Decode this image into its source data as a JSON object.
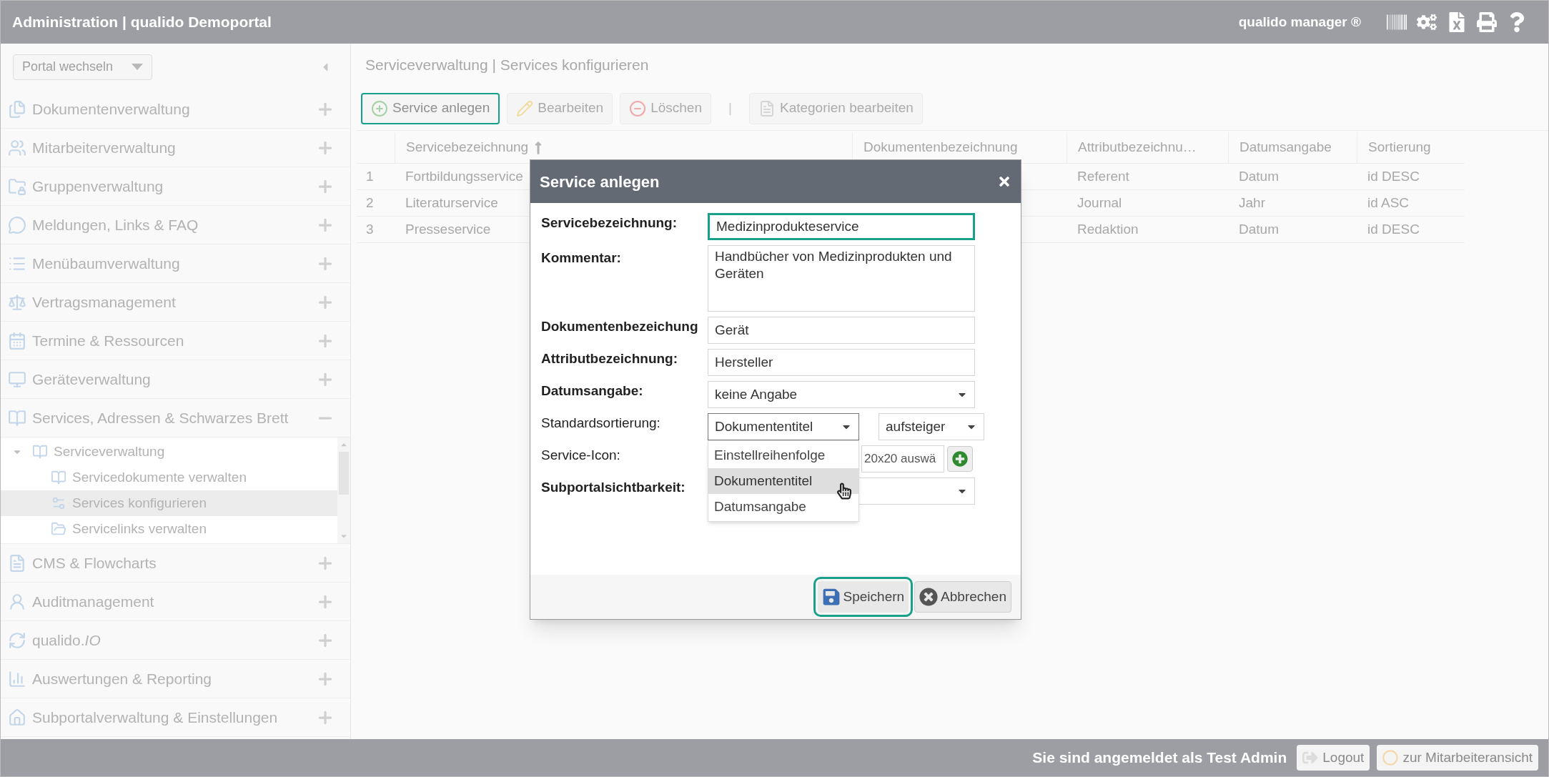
{
  "header": {
    "title": "Administration | qualido Demoportal",
    "product": "qualido manager ®"
  },
  "sidebar": {
    "portal_select": {
      "value": "Portal wechseln"
    },
    "items": [
      {
        "label": "Dokumentenverwaltung",
        "expanded": false
      },
      {
        "label": "Mitarbeiterverwaltung",
        "expanded": false
      },
      {
        "label": "Gruppenverwaltung",
        "expanded": false
      },
      {
        "label": "Meldungen, Links & FAQ",
        "expanded": false
      },
      {
        "label": "Menübaumverwaltung",
        "expanded": false
      },
      {
        "label": "Vertragsmanagement",
        "expanded": false
      },
      {
        "label": "Termine & Ressourcen",
        "expanded": false
      },
      {
        "label": "Geräteverwaltung",
        "expanded": false
      },
      {
        "label": "Services, Adressen & Schwarzes Brett",
        "expanded": true,
        "children": [
          {
            "label": "Serviceverwaltung",
            "expanded": true,
            "selected": false,
            "children": [
              {
                "label": "Servicedokumente verwalten",
                "selected": false
              },
              {
                "label": "Services konfigurieren",
                "selected": true
              },
              {
                "label": "Servicelinks verwalten",
                "selected": false
              }
            ]
          }
        ]
      },
      {
        "label": "CMS & Flowcharts",
        "expanded": false
      },
      {
        "label": "Auditmanagement",
        "expanded": false
      },
      {
        "label": "qualido.*IO*",
        "expanded": false
      },
      {
        "label": "Auswertungen & Reporting",
        "expanded": false
      },
      {
        "label": "Subportalverwaltung & Einstellungen",
        "expanded": false
      }
    ]
  },
  "content": {
    "breadcrumb": "Serviceverwaltung | Services konfigurieren",
    "toolbar": [
      {
        "kind": "add",
        "label": "Service anlegen",
        "disabled": false,
        "focused": true
      },
      {
        "kind": "edit",
        "label": "Bearbeiten",
        "disabled": true,
        "focused": false
      },
      {
        "kind": "delete",
        "label": "Löschen",
        "disabled": true,
        "focused": false
      },
      {
        "kind": "separator",
        "label": "|"
      },
      {
        "kind": "categories",
        "label": "Kategorien bearbeiten",
        "disabled": true,
        "focused": false
      }
    ],
    "table": {
      "columns": [
        {
          "label": "Servicebezeichnung",
          "sorted": true
        },
        {
          "label": "Dokumentenbezeichnung",
          "sorted": false
        },
        {
          "label": "Attributbezeichnu…",
          "sorted": false
        },
        {
          "label": "Datumsangabe",
          "sorted": false
        },
        {
          "label": "Sortierung",
          "sorted": false
        }
      ],
      "rows": [
        {
          "number": "1",
          "service": "Fortbildungsservice",
          "attribute": "Referent",
          "date": "Datum",
          "sort": "id DESC"
        },
        {
          "number": "2",
          "service": "Literaturservice",
          "attribute": "Journal",
          "date": "Jahr",
          "sort": "id ASC"
        },
        {
          "number": "3",
          "service": "Presseservice",
          "attribute": "Redaktion",
          "date": "Datum",
          "sort": "id DESC"
        }
      ]
    }
  },
  "dialog": {
    "title": "Service anlegen",
    "fields": [
      {
        "kind": "input",
        "label": "Servicebezeichnung:",
        "bold": true,
        "value": "Medizinprodukteservice",
        "focused": true
      },
      {
        "kind": "textarea",
        "label": "Kommentar:",
        "bold": true,
        "value": "Handbücher von Medizinprodukten und Geräten",
        "focused": false
      },
      {
        "kind": "input",
        "label": "Dokumentenbezeichung",
        "bold": true,
        "value": "Gerät",
        "focused": false
      },
      {
        "kind": "input",
        "label": "Attributbezeichnung:",
        "bold": true,
        "value": "Hersteller",
        "focused": false
      },
      {
        "kind": "select",
        "label": "Datumsangabe:",
        "bold": true,
        "value": "keine Angabe"
      },
      {
        "kind": "sort",
        "label": "Standardsortierung:",
        "bold": false,
        "value": "Dokumententitel",
        "order_value": "aufsteiger",
        "expanded": true,
        "options": [
          {
            "label": "Einstellreihenfolge",
            "selected": false
          },
          {
            "label": "Dokumententitel",
            "selected": true
          },
          {
            "label": "Datumsangabe",
            "selected": false
          }
        ]
      },
      {
        "kind": "icon",
        "label": "Service-Icon:",
        "bold": false,
        "value": "20x20 auswä"
      },
      {
        "kind": "select",
        "label": "Subportalsichtbarkeit:",
        "bold": true
      }
    ],
    "buttons": [
      {
        "kind": "save",
        "label": "Speichern",
        "focused": true
      },
      {
        "kind": "cancel",
        "label": "Abbrechen",
        "focused": false
      }
    ]
  },
  "footer": {
    "login_text": "Sie sind angemeldet als **Test Admin**",
    "buttons": [
      {
        "kind": "logout",
        "label": "Logout"
      },
      {
        "kind": "employee_view",
        "label": "zur Mitarbeiteransicht"
      }
    ]
  }
}
